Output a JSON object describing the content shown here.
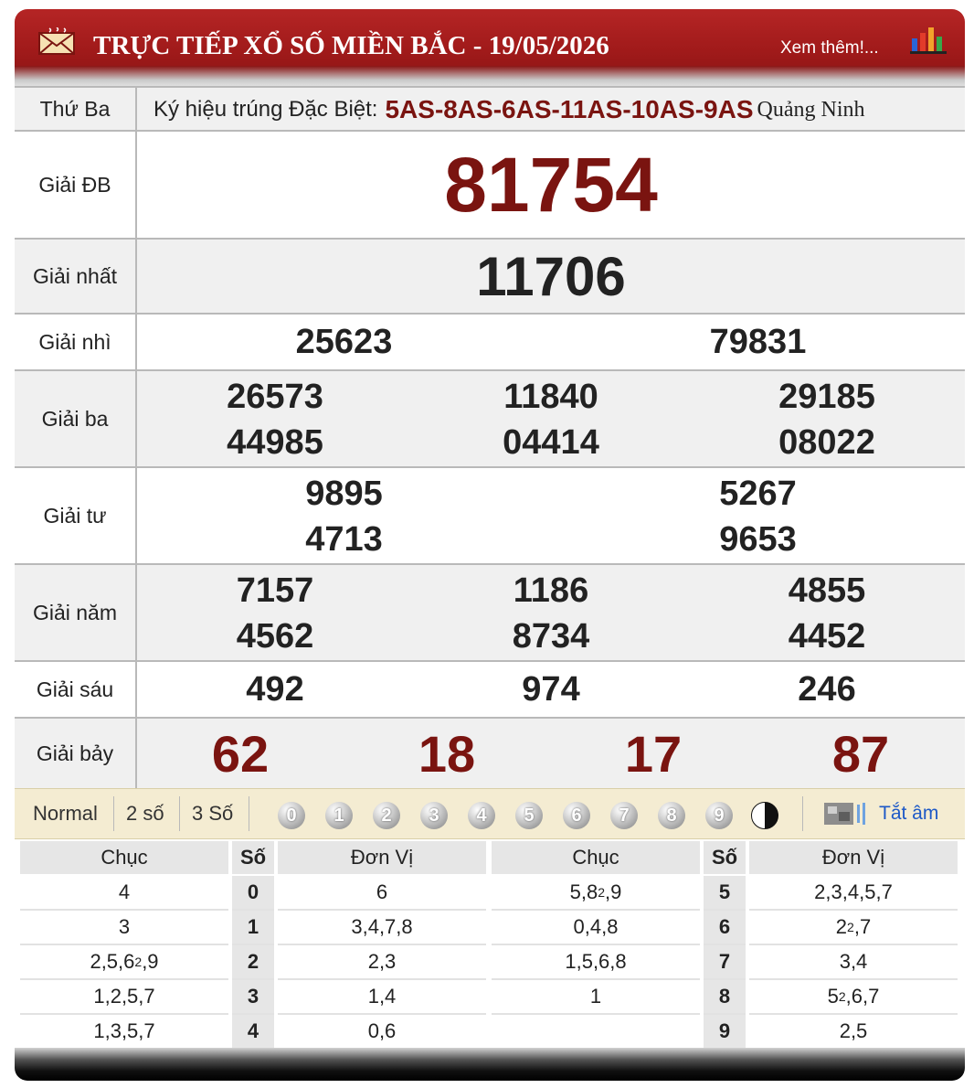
{
  "header": {
    "title": "TRỰC TIẾP XỔ SỐ MIỀN BẮC - 19/05/2026",
    "more_link": "Xem thêm!..."
  },
  "info": {
    "day": "Thứ Ba",
    "symbol_label": "Ký hiệu trúng Đặc Biệt:",
    "symbol_codes": "5AS-8AS-6AS-11AS-10AS-9AS",
    "province": "Quảng Ninh"
  },
  "prizes": {
    "db": {
      "label": "Giải ĐB",
      "numbers": [
        "81754"
      ]
    },
    "nhat": {
      "label": "Giải nhất",
      "numbers": [
        "11706"
      ]
    },
    "nhi": {
      "label": "Giải nhì",
      "numbers": [
        "25623",
        "79831"
      ]
    },
    "ba": {
      "label": "Giải ba",
      "numbers": [
        "26573",
        "11840",
        "29185",
        "44985",
        "04414",
        "08022"
      ]
    },
    "tu": {
      "label": "Giải tư",
      "numbers": [
        "9895",
        "5267",
        "4713",
        "9653"
      ]
    },
    "nam": {
      "label": "Giải năm",
      "numbers": [
        "7157",
        "1186",
        "4855",
        "4562",
        "8734",
        "4452"
      ]
    },
    "sau": {
      "label": "Giải sáu",
      "numbers": [
        "492",
        "974",
        "246"
      ]
    },
    "bay": {
      "label": "Giải bảy",
      "numbers": [
        "62",
        "18",
        "17",
        "87"
      ]
    }
  },
  "options": {
    "normal": "Normal",
    "two": "2 số",
    "three": "3 Số",
    "digits": [
      "0",
      "1",
      "2",
      "3",
      "4",
      "5",
      "6",
      "7",
      "8",
      "9"
    ],
    "mute": "Tắt âm"
  },
  "stats": {
    "headers": {
      "chuc": "Chục",
      "so": "Số",
      "donvi": "Đơn Vị"
    },
    "left": [
      {
        "chuc": "4",
        "so": "0",
        "donvi": "6"
      },
      {
        "chuc": "3",
        "so": "1",
        "donvi": "3,4,7,8"
      },
      {
        "chuc": "2,5,6²,9",
        "so": "2",
        "donvi": "2,3"
      },
      {
        "chuc": "1,2,5,7",
        "so": "3",
        "donvi": "1,4"
      },
      {
        "chuc": "1,3,5,7",
        "so": "4",
        "donvi": "0,6"
      }
    ],
    "right": [
      {
        "chuc": "5,8²,9",
        "so": "5",
        "donvi": "2,3,4,5,7"
      },
      {
        "chuc": "0,4,8",
        "so": "6",
        "donvi": "2²,7"
      },
      {
        "chuc": "1,5,6,8",
        "so": "7",
        "donvi": "3,4"
      },
      {
        "chuc": "1",
        "so": "8",
        "donvi": "5²,6,7"
      },
      {
        "chuc": "",
        "so": "9",
        "donvi": "2,5"
      }
    ]
  },
  "colors": {
    "header_red": "#a01a1a",
    "prize_red": "#7a1410",
    "link_blue": "#1d59c7"
  }
}
